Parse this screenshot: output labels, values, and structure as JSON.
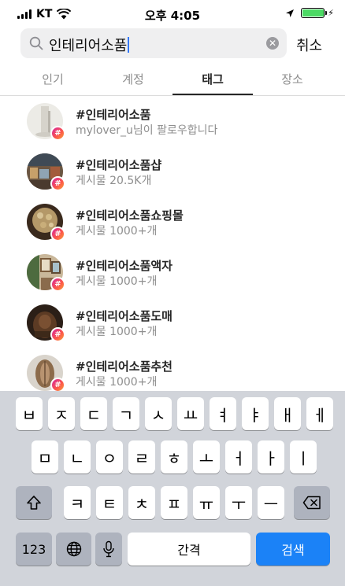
{
  "status_bar": {
    "carrier": "KT",
    "time": "오후 4:05",
    "battery_level": 0.95
  },
  "search": {
    "query": "인테리어소품",
    "cancel_label": "취소"
  },
  "tabs": [
    {
      "label": "인기"
    },
    {
      "label": "계정"
    },
    {
      "label": "태그",
      "selected": true
    },
    {
      "label": "장소"
    }
  ],
  "results": [
    {
      "name": "#인테리어소품",
      "subtitle": "mylover_u님이 팔로우합니다",
      "badge": "#"
    },
    {
      "name": "#인테리어소품샵",
      "subtitle": "게시물 20.5K개",
      "badge": "#"
    },
    {
      "name": "#인테리어소품쇼핑몰",
      "subtitle": "게시물 1000+개",
      "badge": "#"
    },
    {
      "name": "#인테리어소품액자",
      "subtitle": "게시물 1000+개",
      "badge": "#"
    },
    {
      "name": "#인테리어소품도매",
      "subtitle": "게시물 1000+개",
      "badge": "#"
    },
    {
      "name": "#인테리어소품추천",
      "subtitle": "게시물 1000+개",
      "badge": "#"
    }
  ],
  "keyboard": {
    "row1": [
      "ㅂ",
      "ㅈ",
      "ㄷ",
      "ㄱ",
      "ㅅ",
      "ㅛ",
      "ㅕ",
      "ㅑ",
      "ㅐ",
      "ㅔ"
    ],
    "row2": [
      "ㅁ",
      "ㄴ",
      "ㅇ",
      "ㄹ",
      "ㅎ",
      "ㅗ",
      "ㅓ",
      "ㅏ",
      "ㅣ"
    ],
    "row3": [
      "ㅋ",
      "ㅌ",
      "ㅊ",
      "ㅍ",
      "ㅠ",
      "ㅜ",
      "ㅡ"
    ],
    "numbers_label": "123",
    "space_label": "간격",
    "search_label": "검색",
    "icons": {
      "shift": "shift-icon",
      "delete": "backspace-icon",
      "globe": "globe-icon",
      "mic": "microphone-icon"
    }
  },
  "colors": {
    "accent_blue": "#1b82f7",
    "keyboard_bg": "#d1d4da",
    "tag_gradient": [
      "#d6249f",
      "#fd5949",
      "#f7a23b"
    ]
  }
}
